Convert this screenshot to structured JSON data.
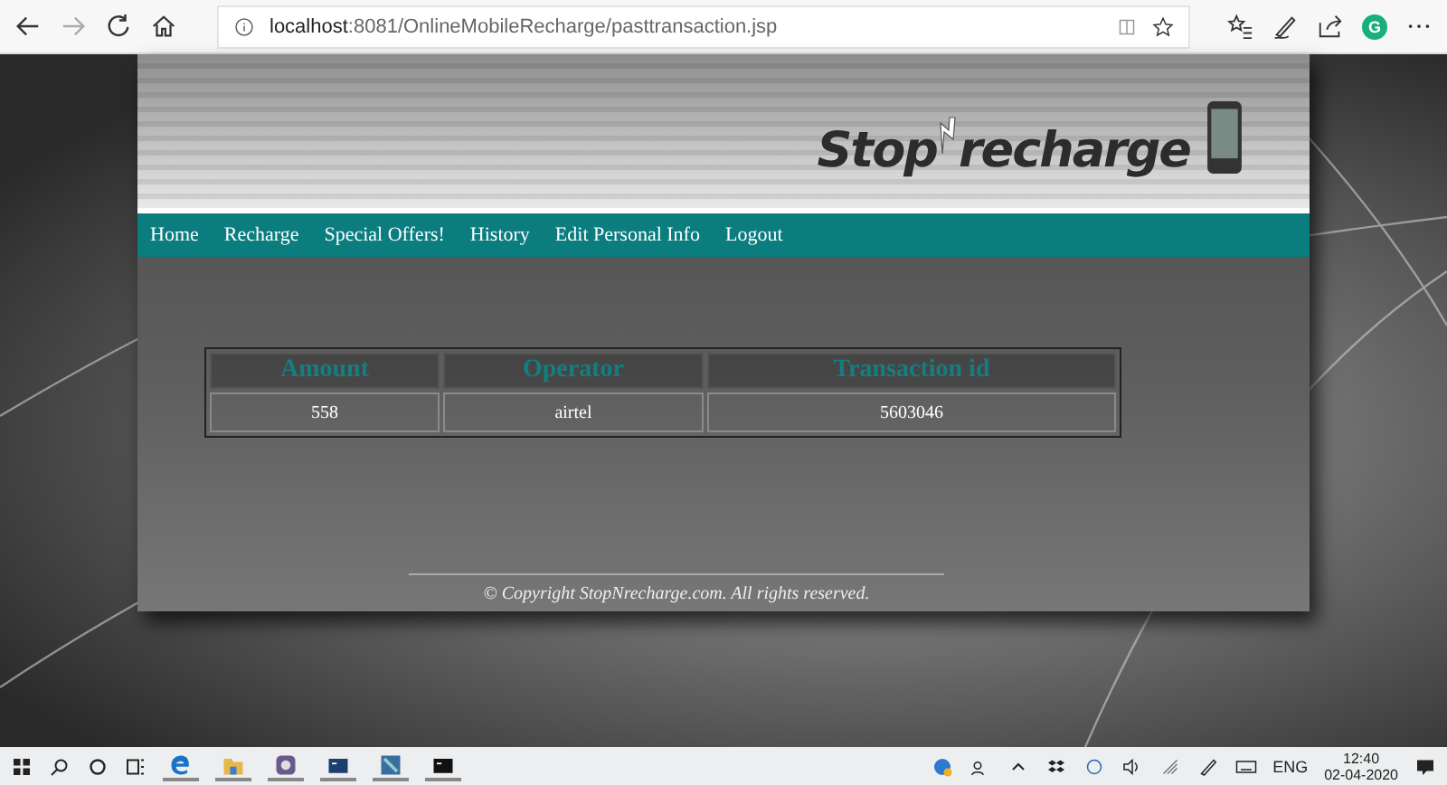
{
  "browser": {
    "address": "**localhost**:8081/OnlineMobileRecharge/pasttransaction.jsp",
    "profile_initial": "G"
  },
  "logo": {
    "first": "Stop",
    "second": "recharge"
  },
  "nav": [
    {
      "label": "Home"
    },
    {
      "label": "Recharge"
    },
    {
      "label": "Special Offers!"
    },
    {
      "label": "History"
    },
    {
      "label": "Edit Personal Info"
    },
    {
      "label": "Logout"
    }
  ],
  "table": {
    "columns": [
      "Amount",
      "Operator",
      "Transaction id"
    ],
    "rows": [
      [
        "558",
        "airtel",
        "5603046"
      ]
    ]
  },
  "footer": "© Copyright StopNrecharge.com. All rights reserved.",
  "taskbar": {
    "language": "ENG",
    "time": "12:40",
    "date": "02-04-2020"
  }
}
